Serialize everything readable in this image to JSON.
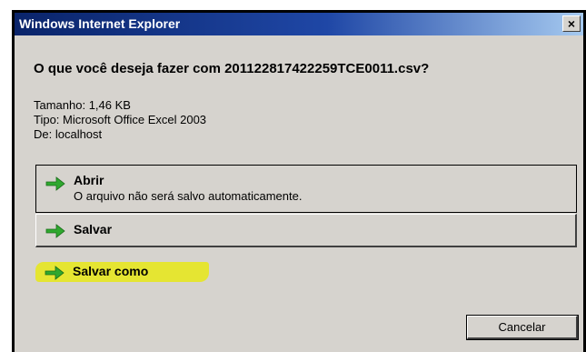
{
  "window": {
    "title": "Windows Internet Explorer",
    "close_glyph": "×"
  },
  "dialog": {
    "question": "O que você deseja fazer com 201122817422259TCE0011.csv?",
    "size": "Tamanho: 1,46 KB",
    "type": "Tipo: Microsoft Office Excel 2003",
    "from": "De: localhost"
  },
  "options": {
    "open": {
      "label": "Abrir",
      "sub": "O arquivo não será salvo automaticamente.",
      "icon": "green-arrow-icon"
    },
    "save": {
      "label": "Salvar",
      "icon": "green-arrow-icon"
    },
    "save_as": {
      "label": "Salvar como",
      "icon": "green-arrow-icon",
      "highlight_color": "#e8e816"
    }
  },
  "buttons": {
    "cancel": "Cancelar"
  },
  "colors": {
    "title_start": "#0a246a",
    "title_end": "#a6caf0",
    "dialog_bg": "#d6d3ce",
    "arrow": "#2fa82f"
  }
}
